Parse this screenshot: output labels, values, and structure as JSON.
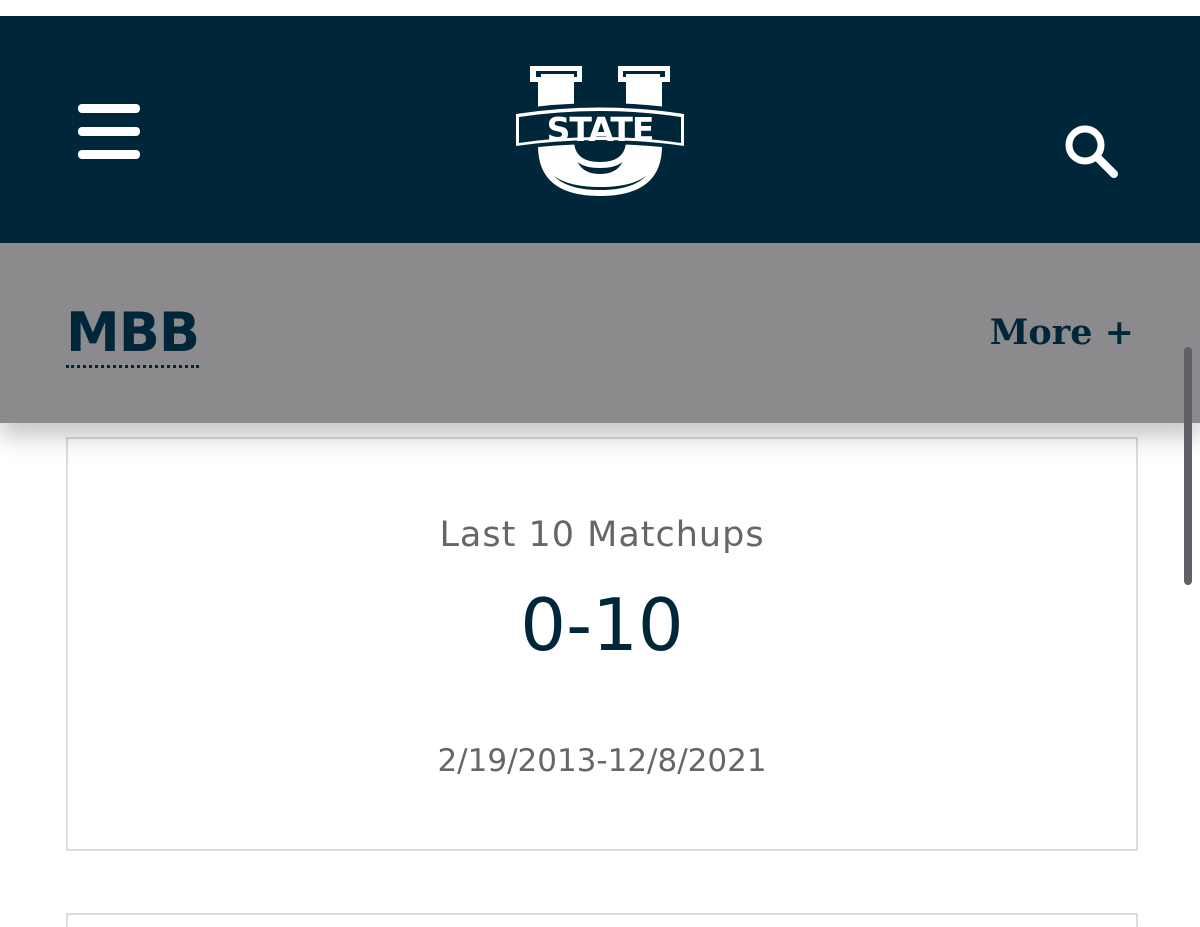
{
  "header": {
    "background_color": "#00263a",
    "menu_icon": "hamburger-menu-icon",
    "logo_text": "STATE",
    "search_icon": "search-icon"
  },
  "subnav": {
    "background_color": "#8b8b8e",
    "sport_label": "MBB",
    "more_label": "More +"
  },
  "matchup_card": {
    "label": "Last 10 Matchups",
    "record": "0-10",
    "date_range": "2/19/2013-12/8/2021"
  },
  "colors": {
    "navy": "#00263a",
    "gray_text": "#666666",
    "card_border": "#dcdcdc"
  }
}
